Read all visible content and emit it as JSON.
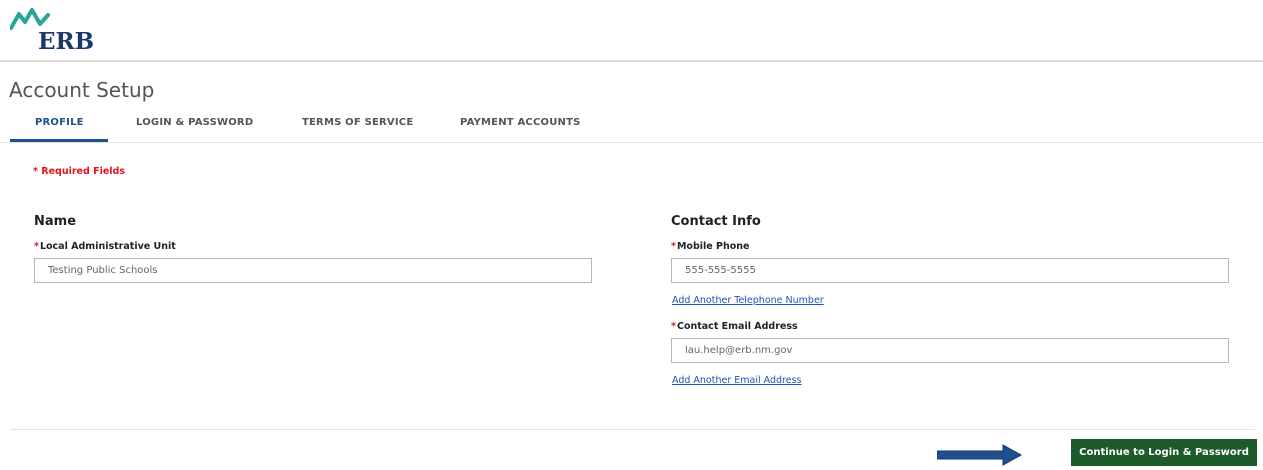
{
  "brand": {
    "logo_text": "ERB",
    "accent_teal": "#2aa59a",
    "navy": "#1b3a6b"
  },
  "page": {
    "title": "Account Setup"
  },
  "tabs": [
    {
      "label": "PROFILE",
      "active": true
    },
    {
      "label": "LOGIN & PASSWORD",
      "active": false
    },
    {
      "label": "TERMS OF SERVICE",
      "active": false
    },
    {
      "label": "PAYMENT ACCOUNTS",
      "active": false
    }
  ],
  "required_note": "* Required Fields",
  "name_section": {
    "title": "Name",
    "lau_label": "Local Administrative Unit",
    "lau_value": "Testing Public Schools"
  },
  "contact_section": {
    "title": "Contact Info",
    "phone_label": "Mobile Phone",
    "phone_value": "555-555-5555",
    "add_phone_link": "Add Another Telephone Number",
    "email_label": "Contact Email Address",
    "email_value": "lau.help@erb.nm.gov",
    "add_email_link": "Add Another Email Address"
  },
  "footer": {
    "continue_label": "Continue to Login & Password",
    "continue_color": "#1e5b2a",
    "arrow_color": "#1f4f8f",
    "arrow_icon": "arrow-right"
  },
  "colors": {
    "required_red": "#e3131c",
    "link_blue": "#1a56b7",
    "tab_active": "#1f4f8f"
  }
}
